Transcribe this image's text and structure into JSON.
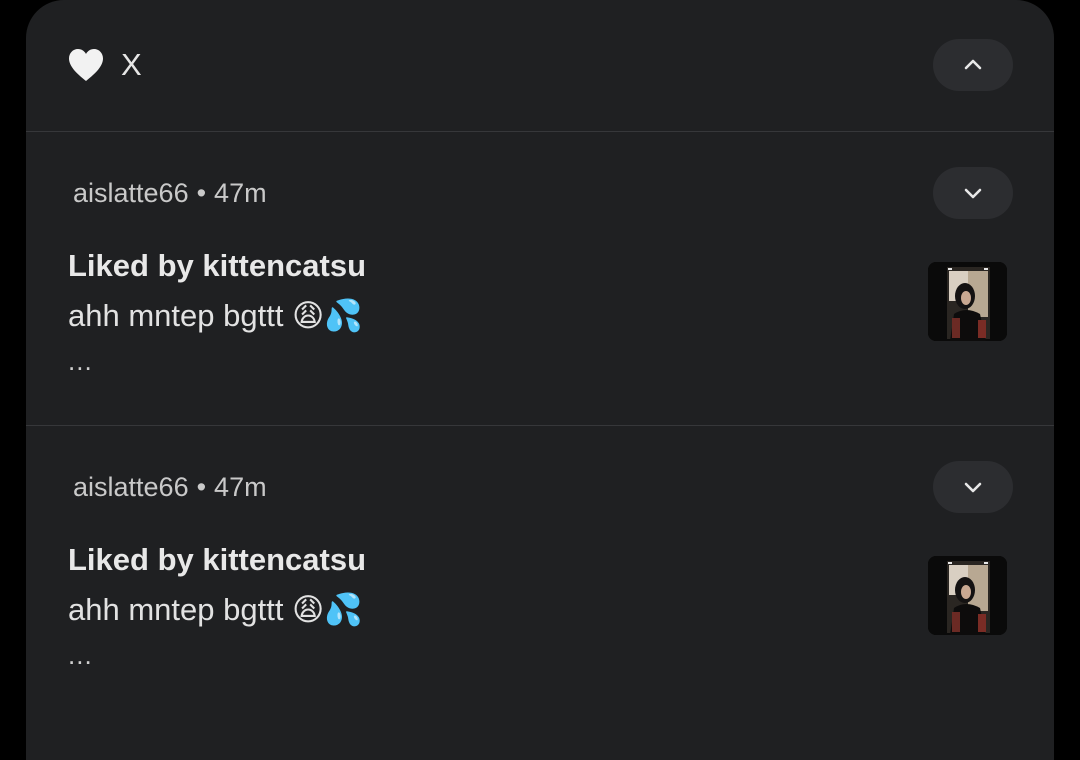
{
  "header": {
    "app_name": "X",
    "app_icon": "heart-icon"
  },
  "notifications": [
    {
      "account": "aislatte66",
      "separator": "•",
      "time": "47m",
      "title": "Liked by kittencatsu",
      "body": "ahh mntep bgttt 😩💦",
      "more": "...",
      "thumbnail": "post-thumbnail"
    },
    {
      "account": "aislatte66",
      "separator": "•",
      "time": "47m",
      "title": "Liked by kittencatsu",
      "body": "ahh mntep bgttt 😩💦",
      "more": "...",
      "thumbnail": "post-thumbnail"
    }
  ],
  "colors": {
    "panel_bg": "#1f2022",
    "button_bg": "#2c2d30",
    "divider": "#36373a",
    "text_primary": "#e8e8e8",
    "text_secondary": "#c9c9c9"
  }
}
